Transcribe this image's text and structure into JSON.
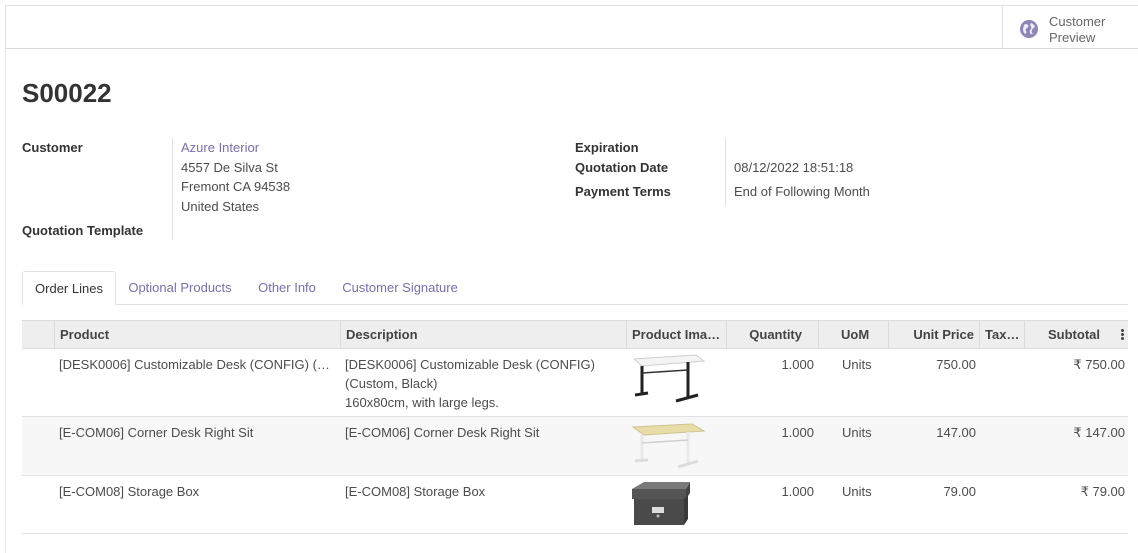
{
  "topbar": {
    "preview_label_1": "Customer",
    "preview_label_2": "Preview"
  },
  "order": {
    "name": "S00022",
    "customer_label": "Customer",
    "customer_name": "Azure Interior",
    "address_line1": "4557 De Silva St",
    "address_line2": "Fremont CA 94538",
    "address_line3": "United States",
    "template_label": "Quotation Template",
    "expiration_label": "Expiration",
    "quotation_date_label": "Quotation Date",
    "quotation_date": "08/12/2022 18:51:18",
    "payment_terms_label": "Payment Terms",
    "payment_terms": "End of Following Month"
  },
  "tabs": [
    "Order Lines",
    "Optional Products",
    "Other Info",
    "Customer Signature"
  ],
  "table": {
    "headers": {
      "product": "Product",
      "description": "Description",
      "image": "Product Ima…",
      "quantity": "Quantity",
      "uom": "UoM",
      "unit_price": "Unit Price",
      "tax": "Tax…",
      "subtotal": "Subtotal"
    },
    "rows": [
      {
        "product": "[DESK0006] Customizable Desk (CONFIG) (…",
        "desc1": "[DESK0006] Customizable Desk (CONFIG)",
        "desc2": "(Custom, Black)",
        "desc3": "160x80cm, with large legs.",
        "quantity": "1.000",
        "uom": "Units",
        "unit_price": "750.00",
        "subtotal": "₹ 750.00",
        "image_icon": "black-desk-image"
      },
      {
        "product": "[E-COM06] Corner Desk Right Sit",
        "desc1": "[E-COM06] Corner Desk Right Sit",
        "quantity": "1.000",
        "uom": "Units",
        "unit_price": "147.00",
        "subtotal": "₹ 147.00",
        "image_icon": "corner-desk-image"
      },
      {
        "product": "[E-COM08] Storage Box",
        "desc1": "[E-COM08] Storage Box",
        "quantity": "1.000",
        "uom": "Units",
        "unit_price": "79.00",
        "subtotal": "₹ 79.00",
        "image_icon": "storage-box-image"
      }
    ]
  },
  "colors": {
    "link": "#7c6ea8",
    "header_bg": "#eeeeee",
    "globe": "#8e86b6"
  }
}
